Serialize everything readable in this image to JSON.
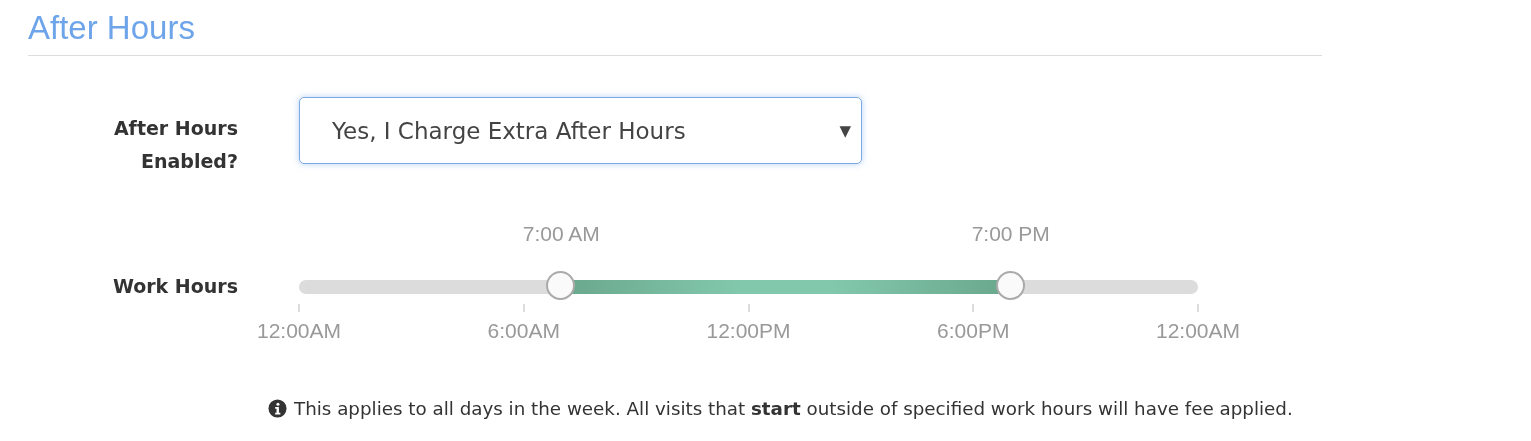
{
  "section": {
    "title": "After Hours"
  },
  "after_hours_field": {
    "label": "After Hours Enabled?",
    "value": "Yes, I Charge Extra After Hours",
    "caret": "▼"
  },
  "work_hours": {
    "label": "Work Hours",
    "handles": [
      {
        "reading": "7:00 AM",
        "level": 0.2917
      },
      {
        "reading": "7:00 PM",
        "level": 0.7917
      }
    ],
    "ticks": [
      "12:00AM",
      "6:00AM",
      "12:00PM",
      "6:00PM",
      "12:00AM"
    ]
  },
  "note": "This applies to all days in the week. All visits that **start** outside of specified work hours will have fee applied."
}
